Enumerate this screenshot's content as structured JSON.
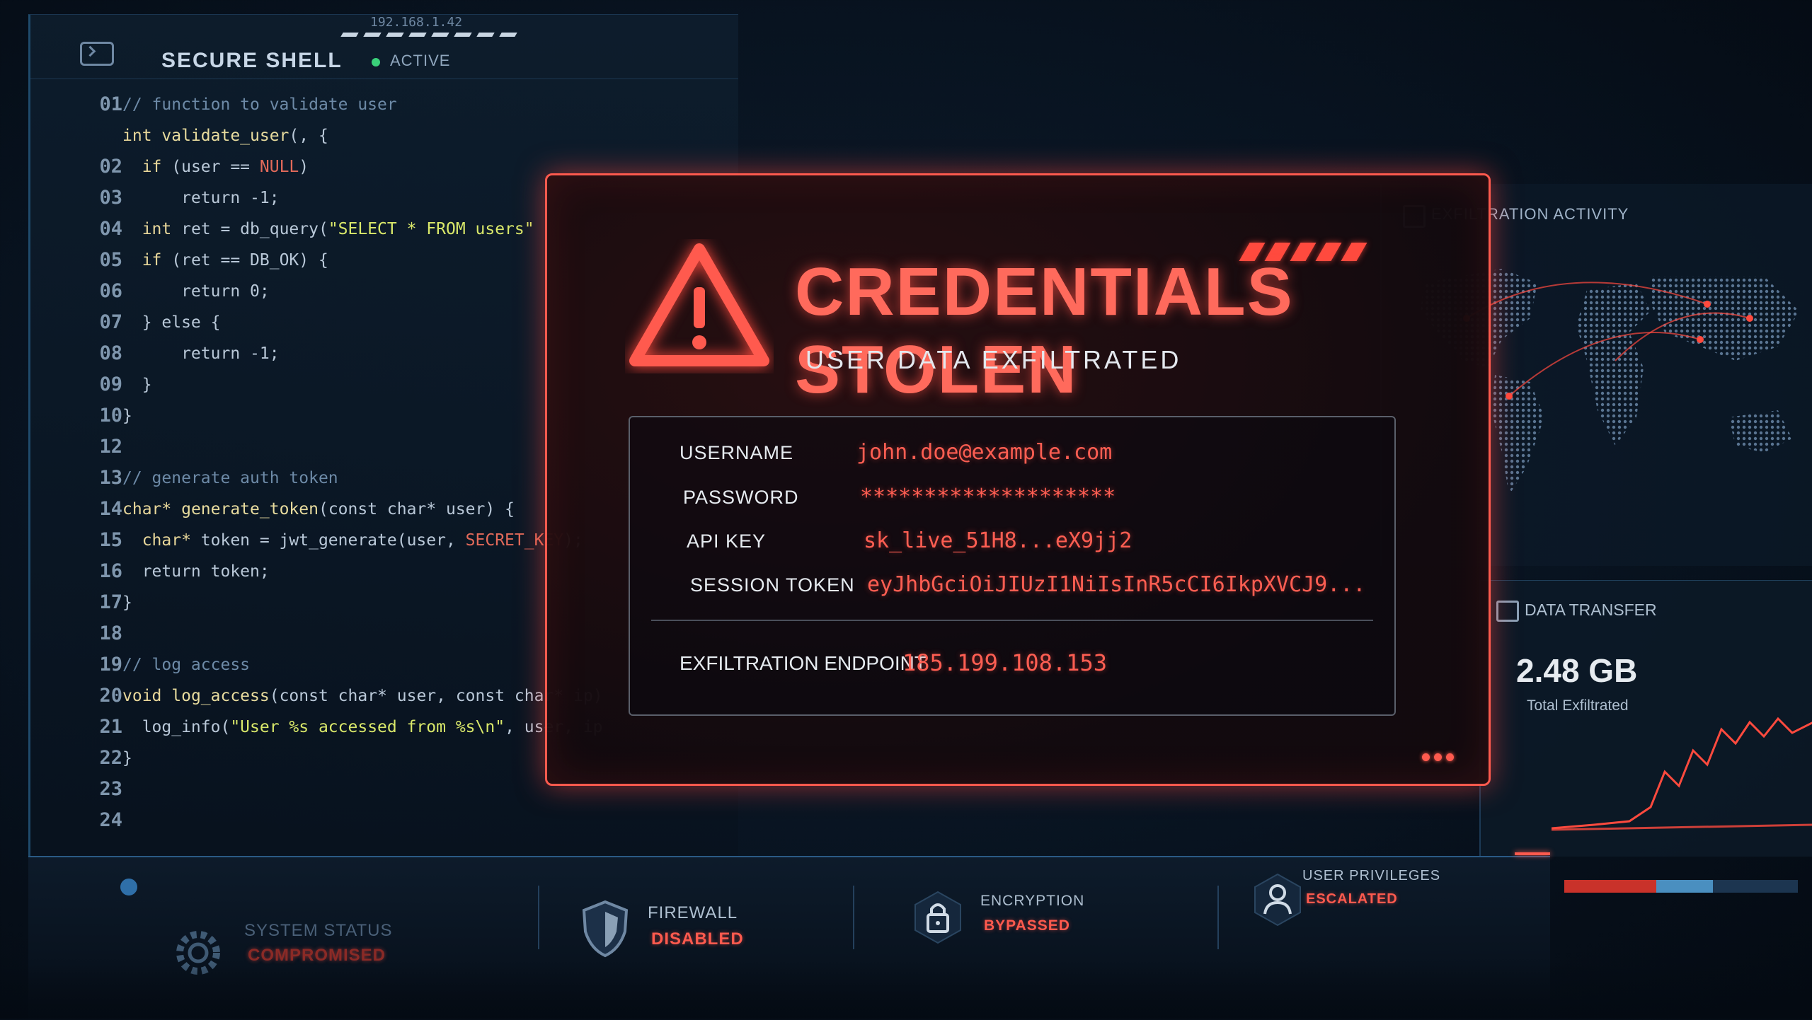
{
  "code_panel": {
    "title": "SECURE SHELL",
    "status": "ACTIVE",
    "ip": "192.168.1.42",
    "line_numbers": [
      "01",
      "",
      "02",
      "03",
      "04",
      "05",
      "06",
      "07",
      "08",
      "09",
      "10",
      "12",
      "13",
      "14",
      "15",
      "16",
      "17",
      "18",
      "19",
      "20",
      "21",
      "22",
      "23",
      "24"
    ],
    "lines": [
      [
        {
          "t": "// function to validate user",
          "c": "cm"
        }
      ],
      [
        {
          "t": "int ",
          "c": "kw"
        },
        {
          "t": "validate_user",
          "c": "fn"
        },
        {
          "t": "(, {",
          "c": ""
        }
      ],
      [
        {
          "t": "  if ",
          "c": "kw"
        },
        {
          "t": "(user == ",
          "c": ""
        },
        {
          "t": "NULL",
          "c": "null"
        },
        {
          "t": ")",
          "c": ""
        }
      ],
      [
        {
          "t": "      return -1;",
          "c": ""
        }
      ],
      [
        {
          "t": "  int ",
          "c": "kw"
        },
        {
          "t": "ret = db_query(",
          "c": ""
        },
        {
          "t": "\"SELECT * FROM users\"",
          "c": "str"
        }
      ],
      [
        {
          "t": "  if ",
          "c": "kw"
        },
        {
          "t": "(ret == DB_OK) {",
          "c": ""
        }
      ],
      [
        {
          "t": "      return 0;",
          "c": ""
        }
      ],
      [
        {
          "t": "  } else {",
          "c": ""
        }
      ],
      [
        {
          "t": "      return -1;",
          "c": ""
        }
      ],
      [
        {
          "t": "  }",
          "c": ""
        }
      ],
      [
        {
          "t": "}",
          "c": ""
        }
      ],
      [
        {
          "t": "",
          "c": ""
        }
      ],
      [
        {
          "t": "// generate auth token",
          "c": "cm"
        }
      ],
      [
        {
          "t": "char* ",
          "c": "kw"
        },
        {
          "t": "generate_token",
          "c": "fn"
        },
        {
          "t": "(const char* user) {",
          "c": ""
        }
      ],
      [
        {
          "t": "  char* ",
          "c": "kw"
        },
        {
          "t": "token = jwt_generate(user, ",
          "c": ""
        },
        {
          "t": "SECRET_KEY",
          "c": "sk"
        },
        {
          "t": ");",
          "c": ""
        }
      ],
      [
        {
          "t": "  return token;",
          "c": ""
        }
      ],
      [
        {
          "t": "}",
          "c": ""
        }
      ],
      [
        {
          "t": "",
          "c": ""
        }
      ],
      [
        {
          "t": "// log access",
          "c": "cm"
        }
      ],
      [
        {
          "t": "void ",
          "c": "kw"
        },
        {
          "t": "log_access",
          "c": "fn"
        },
        {
          "t": "(const char* user, const char* ip)",
          "c": ""
        }
      ],
      [
        {
          "t": "  log_info(",
          "c": ""
        },
        {
          "t": "\"User %s accessed from %s\\n\"",
          "c": "str"
        },
        {
          "t": ", user, ip",
          "c": ""
        }
      ],
      [
        {
          "t": "}",
          "c": ""
        }
      ]
    ]
  },
  "alert": {
    "title": "CREDENTIALS STOLEN",
    "subtitle": "USER DATA EXFILTRATED",
    "credentials": [
      {
        "label": "USERNAME",
        "value": "john.doe@example.com"
      },
      {
        "label": "PASSWORD",
        "value": "********************"
      },
      {
        "label": "API KEY",
        "value": "sk_live_51H8...eX9jj2"
      },
      {
        "label": "SESSION TOKEN",
        "value": "eyJhbGciOiJIUzI1NiIsInR5cCI6IkpXVCJ9..."
      }
    ],
    "endpoint_label": "EXFILTRATION ENDPOINT",
    "endpoint_value": "185.199.108.153"
  },
  "exfil_panel": {
    "title": "EXFILTRATION ACTIVITY"
  },
  "transfer_panel": {
    "title": "DATA TRANSFER",
    "amount": "2.48 GB",
    "caption": "Total Exfiltrated"
  },
  "status_bar": [
    {
      "name": "SYSTEM STATUS",
      "value": "COMPROMISED",
      "icon": "gear-icon"
    },
    {
      "name": "FIREWALL",
      "value": "DISABLED",
      "icon": "shield-icon"
    },
    {
      "name": "ENCRYPTION",
      "value": "BYPASSED",
      "icon": "lock-icon"
    },
    {
      "name": "USER PRIVILEGES",
      "value": "ESCALATED",
      "icon": "user-icon"
    }
  ],
  "colors": {
    "alert": "#ff5a4e",
    "background": "#081320",
    "code_keyword": "#e8d79a",
    "code_string": "#d9e86a",
    "code_comment": "#6d8aa7"
  }
}
